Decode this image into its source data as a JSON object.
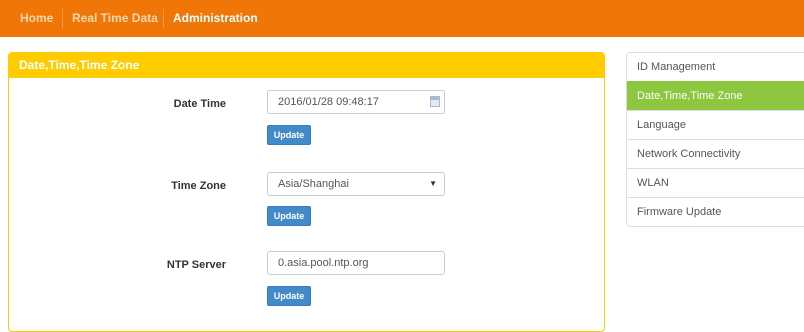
{
  "nav": {
    "items": [
      {
        "label": "Home",
        "active": false
      },
      {
        "label": "Real Time Data",
        "active": false
      },
      {
        "label": "Administration",
        "active": true
      }
    ]
  },
  "panel": {
    "title": "Date,Time,Time Zone",
    "date_time": {
      "label": "Date Time",
      "value": "2016/01/28 09:48:17",
      "icon": "calendar-icon",
      "button": "Update"
    },
    "time_zone": {
      "label": "Time Zone",
      "value": "Asia/Shanghai",
      "button": "Update"
    },
    "ntp_server": {
      "label": "NTP Server",
      "value": "0.asia.pool.ntp.org",
      "button": "Update"
    }
  },
  "sidemenu": {
    "items": [
      {
        "label": "ID Management",
        "active": false
      },
      {
        "label": "Date,Time,Time Zone",
        "active": true
      },
      {
        "label": "Language",
        "active": false
      },
      {
        "label": "Network Connectivity",
        "active": false
      },
      {
        "label": "WLAN",
        "active": false
      },
      {
        "label": "Firmware Update",
        "active": false
      }
    ]
  },
  "colors": {
    "nav_bg": "#f07707",
    "panel_header": "#ffcc00",
    "menu_active": "#8dc63f",
    "button": "#428bca"
  }
}
